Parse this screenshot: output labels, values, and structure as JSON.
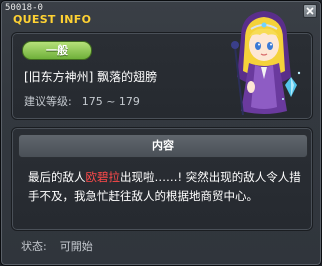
{
  "window": {
    "quest_id": "50018-0",
    "title": "QUEST INFO"
  },
  "quest": {
    "category_badge": "一般",
    "name": "[旧东方神州] 飘落的翅膀",
    "level_label": "建议等级:",
    "level_range": "175 ~ 179"
  },
  "description": {
    "header": "内容",
    "text_before": "最后的敌人",
    "highlight_name": "欧碧拉",
    "text_after": "出现啦……! 突然出现的敌人令人措手不及，我急忙赶往敌人的根据地商贸中心。"
  },
  "status": {
    "label": "状态:",
    "value": "可開始"
  },
  "colors": {
    "title": "#ffd233",
    "badge_green": "#7dbb45",
    "highlight": "#ff4a4a"
  }
}
